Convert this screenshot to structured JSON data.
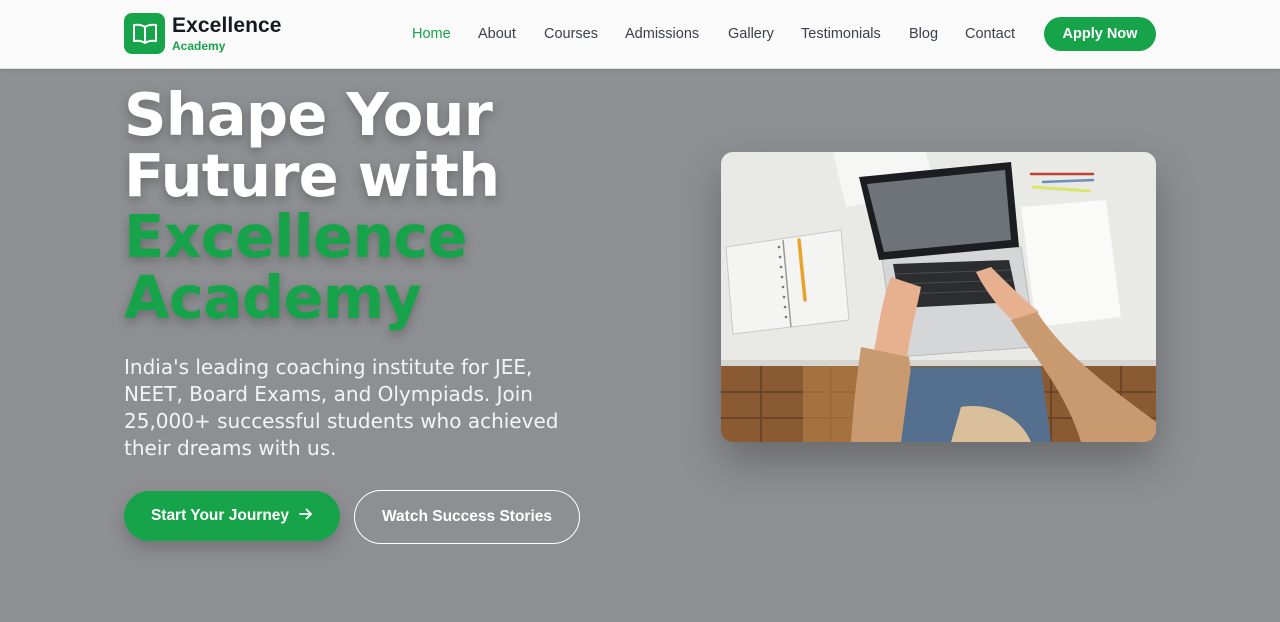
{
  "brand": {
    "name": "Excellence",
    "subtitle": "Academy",
    "icon": "open-book-icon",
    "accent_color": "#17a34a"
  },
  "nav": {
    "links": [
      {
        "label": "Home",
        "active": true
      },
      {
        "label": "About",
        "active": false
      },
      {
        "label": "Courses",
        "active": false
      },
      {
        "label": "Admissions",
        "active": false
      },
      {
        "label": "Gallery",
        "active": false
      },
      {
        "label": "Testimonials",
        "active": false
      },
      {
        "label": "Blog",
        "active": false
      },
      {
        "label": "Contact",
        "active": false
      }
    ],
    "cta_label": "Apply Now"
  },
  "hero": {
    "title_line1": "Shape Your",
    "title_line2": "Future with",
    "title_accent_line1": "Excellence",
    "title_accent_line2": "Academy",
    "description": "India's leading coaching institute for JEE, NEET, Board Exams, and Olympiads. Join 25,000+ successful students who achieved their dreams with us.",
    "primary_cta": "Start Your Journey",
    "primary_cta_icon": "arrow-right-icon",
    "secondary_cta": "Watch Success Stories",
    "image_subject": "student-laptop-photo"
  }
}
